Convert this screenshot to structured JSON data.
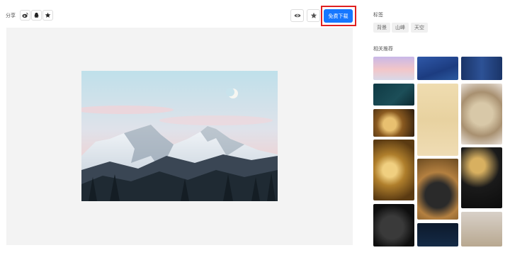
{
  "share": {
    "label": "分享",
    "buttons": [
      {
        "name": "weibo-icon"
      },
      {
        "name": "qq-icon"
      },
      {
        "name": "star-icon"
      }
    ]
  },
  "toolbar": {
    "view_icon": "eye-icon",
    "favorite_icon": "star-icon",
    "download_label": "免费下载",
    "accent": "#1677ff",
    "highlight_color": "#e02020"
  },
  "preview": {
    "background": "#f3f3f3",
    "image": "snowy-mountain-landscape"
  },
  "sidebar": {
    "tags_title": "标签",
    "tags": [
      "背景",
      "山峰",
      "天空"
    ],
    "related_title": "相关推荐"
  }
}
